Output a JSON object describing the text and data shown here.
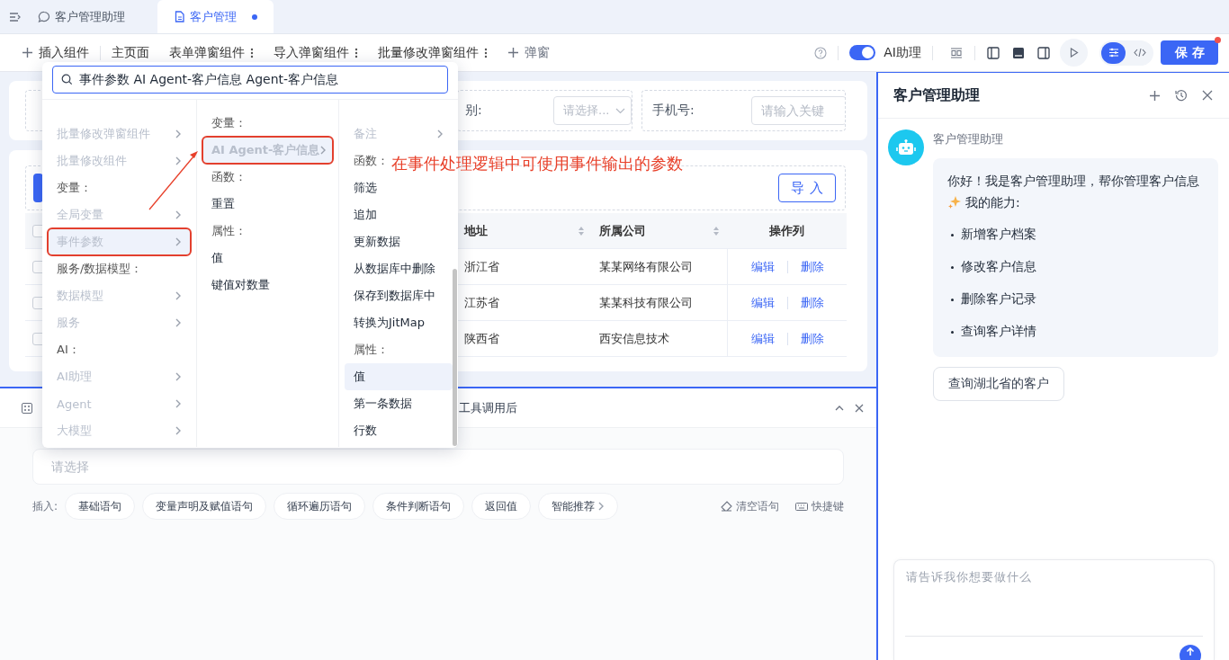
{
  "tab_bar": {
    "tabs": [
      {
        "label": "客户管理助理",
        "selected": false,
        "unsaved": false
      },
      {
        "label": "客户管理",
        "selected": true,
        "unsaved": true
      }
    ]
  },
  "toolbar": {
    "insert_label": "插入组件",
    "pages": [
      {
        "label": "主页面",
        "has_menu": false
      },
      {
        "label": "表单弹窗组件",
        "has_menu": true
      },
      {
        "label": "导入弹窗组件",
        "has_menu": true
      },
      {
        "label": "批量修改弹窗组件",
        "has_menu": true
      }
    ],
    "add_popup_label": "弹窗",
    "ai_assistant": {
      "label": "AI助理",
      "on": true
    },
    "view_modes": [
      {
        "selected": true
      },
      {
        "selected": false
      }
    ],
    "save_label": "保存",
    "save_badge": true
  },
  "filter_form": {
    "fields": [
      {
        "label": "别:",
        "placeholder": "请选择...",
        "kind": "select"
      },
      {
        "label": "手机号:",
        "placeholder": "请输入关键",
        "kind": "text"
      }
    ]
  },
  "table": {
    "import_label": "导入",
    "header_checked": false,
    "columns": [
      {
        "label": "地址",
        "sortable": true
      },
      {
        "label": "所属公司",
        "sortable": true
      },
      {
        "label": "操作列",
        "sortable": false
      }
    ],
    "rows": [
      {
        "checked": false,
        "cells": [
          "浙江省",
          "某某网络有限公司"
        ],
        "actions": [
          "编辑",
          "删除"
        ]
      },
      {
        "checked": false,
        "cells": [
          "江苏省",
          "某某科技有限公司"
        ],
        "actions": [
          "编辑",
          "删除"
        ]
      },
      {
        "checked": false,
        "cells": [
          "陕西省",
          "西安信息技术"
        ],
        "actions": [
          "编辑",
          "删除"
        ]
      }
    ]
  },
  "insert_menu": {
    "search_value": "事件参数 AI Agent-客户信息 Agent-客户信息",
    "columns": [
      {
        "items": [
          {
            "kind": "item",
            "label": "批量修改弹窗组件",
            "disabled": true,
            "has_children": true,
            "selected": false,
            "outlined": false
          },
          {
            "kind": "item",
            "label": "批量修改组件",
            "disabled": true,
            "has_children": true,
            "selected": false,
            "outlined": false
          },
          {
            "kind": "header",
            "label": "变量："
          },
          {
            "kind": "item",
            "label": "全局变量",
            "disabled": true,
            "has_children": true,
            "selected": false,
            "outlined": false
          },
          {
            "kind": "item",
            "label": "事件参数",
            "disabled": true,
            "has_children": true,
            "selected": true,
            "outlined": true
          },
          {
            "kind": "header",
            "label": "服务/数据模型："
          },
          {
            "kind": "item",
            "label": "数据模型",
            "disabled": true,
            "has_children": true,
            "selected": false,
            "outlined": false
          },
          {
            "kind": "item",
            "label": "服务",
            "disabled": true,
            "has_children": true,
            "selected": false,
            "outlined": false
          },
          {
            "kind": "header",
            "label": "AI："
          },
          {
            "kind": "item",
            "label": "AI助理",
            "disabled": true,
            "has_children": true,
            "selected": false,
            "outlined": false
          },
          {
            "kind": "item",
            "label": "Agent",
            "disabled": true,
            "has_children": true,
            "selected": false,
            "outlined": false
          },
          {
            "kind": "item",
            "label": "大模型",
            "disabled": true,
            "has_children": true,
            "selected": false,
            "outlined": false
          }
        ]
      },
      {
        "items": [
          {
            "kind": "header",
            "label": "变量："
          },
          {
            "kind": "item",
            "label": "AI Agent-客户信息",
            "disabled": true,
            "has_children": true,
            "selected": true,
            "outlined": true
          },
          {
            "kind": "header",
            "label": "函数："
          },
          {
            "kind": "item",
            "label": "重置",
            "disabled": false,
            "has_children": false,
            "selected": false,
            "outlined": false
          },
          {
            "kind": "header",
            "label": "属性："
          },
          {
            "kind": "item",
            "label": "值",
            "disabled": false,
            "has_children": false,
            "selected": false,
            "outlined": false
          },
          {
            "kind": "item",
            "label": "键值对数量",
            "disabled": false,
            "has_children": false,
            "selected": false,
            "outlined": false
          }
        ]
      },
      {
        "items": [
          {
            "kind": "item",
            "label": "备注",
            "disabled": true,
            "has_children": true,
            "selected": false,
            "outlined": false
          },
          {
            "kind": "header",
            "label": "函数："
          },
          {
            "kind": "item",
            "label": "筛选",
            "disabled": false,
            "has_children": false,
            "selected": false,
            "outlined": false
          },
          {
            "kind": "item",
            "label": "追加",
            "disabled": false,
            "has_children": false,
            "selected": false,
            "outlined": false
          },
          {
            "kind": "item",
            "label": "更新数据",
            "disabled": false,
            "has_children": false,
            "selected": false,
            "outlined": false
          },
          {
            "kind": "item",
            "label": "从数据库中删除",
            "disabled": false,
            "has_children": false,
            "selected": false,
            "outlined": false
          },
          {
            "kind": "item",
            "label": "保存到数据库中",
            "disabled": false,
            "has_children": false,
            "selected": false,
            "outlined": false
          },
          {
            "kind": "item",
            "label": "转换为JitMap",
            "disabled": false,
            "has_children": false,
            "selected": false,
            "outlined": false
          },
          {
            "kind": "header",
            "label": "属性："
          },
          {
            "kind": "item",
            "label": "值",
            "disabled": false,
            "has_children": false,
            "selected": true,
            "outlined": false
          },
          {
            "kind": "item",
            "label": "第一条数据",
            "disabled": false,
            "has_children": false,
            "selected": false,
            "outlined": false
          },
          {
            "kind": "item",
            "label": "行数",
            "disabled": false,
            "has_children": false,
            "selected": false,
            "outlined": false
          }
        ]
      }
    ]
  },
  "annotation": {
    "text": "在事件处理逻辑中可使用事件输出的参数"
  },
  "bottom_panel": {
    "tab_label": "工具调用后",
    "statement_placeholder": "请选择",
    "insert_label": "插入:",
    "chips": [
      {
        "label": "基础语句",
        "has_children": false
      },
      {
        "label": "变量声明及赋值语句",
        "has_children": false
      },
      {
        "label": "循环遍历语句",
        "has_children": false
      },
      {
        "label": "条件判断语句",
        "has_children": false
      },
      {
        "label": "返回值",
        "has_children": false
      },
      {
        "label": "智能推荐",
        "has_children": true
      }
    ],
    "actions": [
      {
        "label": "清空语句",
        "kind": "clear"
      },
      {
        "label": "快捷键",
        "kind": "shortcut"
      }
    ]
  },
  "assistant": {
    "title": "客户管理助理",
    "sender": "客户管理助理",
    "greeting": "你好！我是客户管理助理，帮你管理客户信息",
    "abilities_title": "我的能力:",
    "abilities": [
      "新增客户档案",
      "修改客户信息",
      "删除客户记录",
      "查询客户详情"
    ],
    "suggestions": [
      "查询湖北省的客户"
    ],
    "input_placeholder": "请告诉我你想要做什么"
  }
}
